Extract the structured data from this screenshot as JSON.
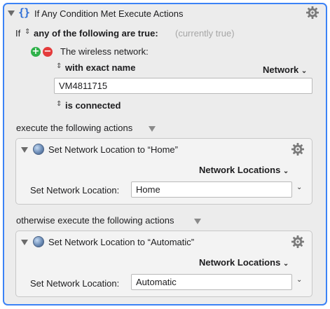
{
  "action": {
    "title": "If Any Condition Met Execute Actions",
    "if_label": "If",
    "mode_label": "any of the following are true:",
    "status": "(currently true)"
  },
  "condition": {
    "label": "The wireless network:",
    "match_label": "with exact name",
    "network_dropdown": "Network",
    "network_value": "VM4811715",
    "state_label": "is connected"
  },
  "then": {
    "label": "execute the following actions",
    "action": {
      "title": "Set Network Location to “Home”",
      "dropdown": "Network Locations",
      "field_label": "Set Network Location:",
      "field_value": "Home"
    }
  },
  "else": {
    "label": "otherwise execute the following actions",
    "action": {
      "title": "Set Network Location to “Automatic”",
      "dropdown": "Network Locations",
      "field_label": "Set Network Location:",
      "field_value": "Automatic"
    }
  },
  "icons": {
    "disclosure": "disclosure-triangle-icon",
    "braces": "curly-braces-icon",
    "gear": "gear-icon",
    "globe": "network-globe-icon",
    "add": "plus-icon",
    "remove": "minus-icon"
  },
  "colors": {
    "accent": "#3b82f6",
    "add": "#2fb14a",
    "remove": "#e43c3c",
    "braces": "#2f6fd6"
  }
}
